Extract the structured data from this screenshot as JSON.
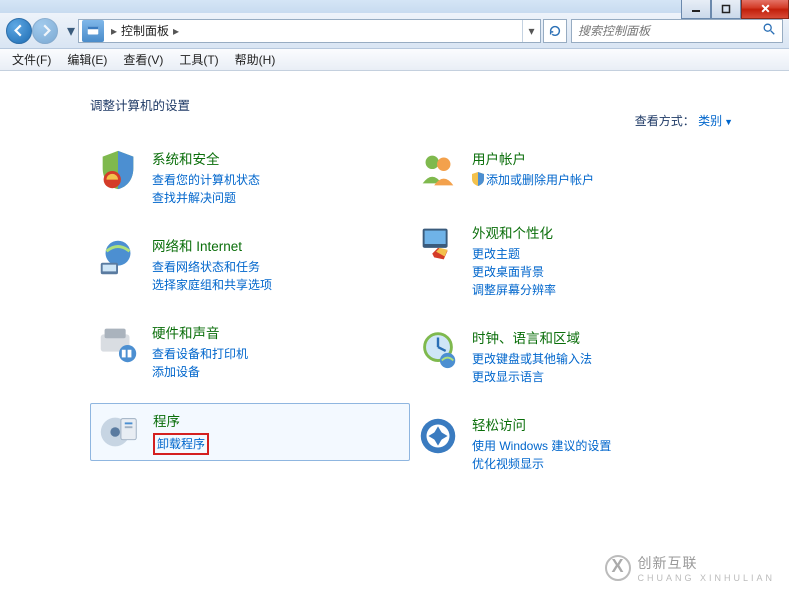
{
  "window": {
    "breadcrumb": "控制面板"
  },
  "search": {
    "placeholder": "搜索控制面板"
  },
  "menubar": {
    "file": "文件(F)",
    "edit": "编辑(E)",
    "view": "查看(V)",
    "tools": "工具(T)",
    "help": "帮助(H)"
  },
  "content": {
    "heading": "调整计算机的设置",
    "view_label": "查看方式：",
    "view_value": "类别"
  },
  "categories": {
    "left": [
      {
        "title": "系统和安全",
        "links": [
          "查看您的计算机状态",
          "查找并解决问题"
        ]
      },
      {
        "title": "网络和 Internet",
        "links": [
          "查看网络状态和任务",
          "选择家庭组和共享选项"
        ]
      },
      {
        "title": "硬件和声音",
        "links": [
          "查看设备和打印机",
          "添加设备"
        ]
      },
      {
        "title": "程序",
        "links": [
          "卸载程序"
        ],
        "highlighted": true,
        "redbox": true
      }
    ],
    "right": [
      {
        "title": "用户帐户",
        "links": [
          "添加或删除用户帐户"
        ],
        "shield": true
      },
      {
        "title": "外观和个性化",
        "links": [
          "更改主题",
          "更改桌面背景",
          "调整屏幕分辨率"
        ]
      },
      {
        "title": "时钟、语言和区域",
        "links": [
          "更改键盘或其他输入法",
          "更改显示语言"
        ]
      },
      {
        "title": "轻松访问",
        "links": [
          "使用 Windows 建议的设置",
          "优化视频显示"
        ]
      }
    ]
  },
  "watermark": {
    "brand": "创新互联",
    "url": "CHUANG XINHULIAN"
  }
}
